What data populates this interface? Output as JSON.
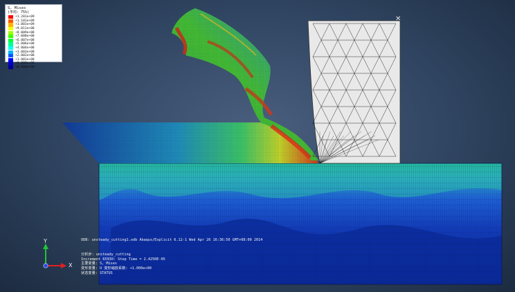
{
  "legend": {
    "title": "S, Mises",
    "subtitle": "(平均: 75%)",
    "entries": [
      {
        "value": "+1.201e+09",
        "color": "#ff0000"
      },
      {
        "value": "+1.101e+09",
        "color": "#ff5a00"
      },
      {
        "value": "+1.001e+09",
        "color": "#ffb400"
      },
      {
        "value": "+9.011e+08",
        "color": "#f5ff00"
      },
      {
        "value": "+8.009e+08",
        "color": "#9bff00"
      },
      {
        "value": "+7.008e+08",
        "color": "#3cff00"
      },
      {
        "value": "+6.007e+08",
        "color": "#00ff3c"
      },
      {
        "value": "+5.006e+08",
        "color": "#00ff9b"
      },
      {
        "value": "+4.004e+08",
        "color": "#00fff5"
      },
      {
        "value": "+3.003e+08",
        "color": "#00b4ff"
      },
      {
        "value": "+2.002e+08",
        "color": "#005aff"
      },
      {
        "value": "+1.001e+08",
        "color": "#0000ff"
      },
      {
        "value": "+0.000e+00",
        "color": "#0000c8"
      },
      {
        "value": "+0.000e+00",
        "color": "#000096"
      }
    ]
  },
  "info": {
    "odb_line": "ODB: unsteady_cutting1.odb    Abaqus/Explicit 6.12-1    Wed Apr 26 16:36:50 GMT+08:00 2014",
    "step_line": "分析步: unsteady_cutting",
    "increment_line": "Increment     65930: Step Time =    2.4250E-05",
    "primary_var_line": "主要变量: S, Mises",
    "deformed_var_line": "变形变量: U  变形缩放系数: +1.000e+00",
    "status_line": "状态变量: STATUS"
  },
  "triad": {
    "y_label": "Y",
    "x_label": "X"
  },
  "colors": {
    "background_center": "#4a5f7f",
    "background_edge": "#1c2b40",
    "tool": "#e9e9e9",
    "mesh_line": "#1a1a1a"
  }
}
